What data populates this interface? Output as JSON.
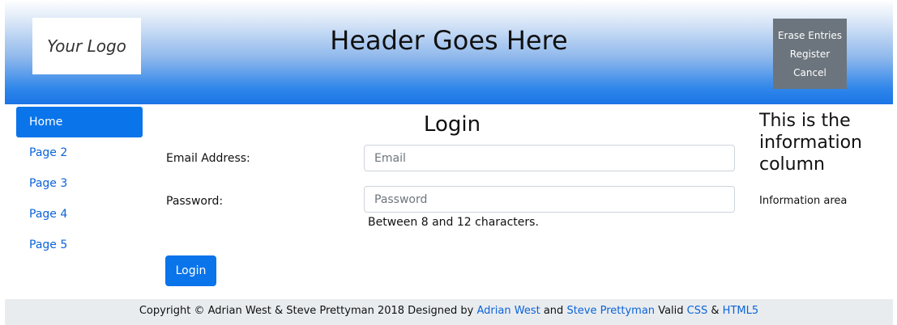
{
  "header": {
    "logo_text": "Your Logo",
    "title": "Header Goes Here",
    "actions": [
      "Erase Entries",
      "Register",
      "Cancel"
    ]
  },
  "sidebar": {
    "items": [
      {
        "label": "Home",
        "active": true
      },
      {
        "label": "Page 2",
        "active": false
      },
      {
        "label": "Page 3",
        "active": false
      },
      {
        "label": "Page 4",
        "active": false
      },
      {
        "label": "Page 5",
        "active": false
      }
    ]
  },
  "main": {
    "title": "Login",
    "email": {
      "label": "Email Address:",
      "placeholder": "Email",
      "value": ""
    },
    "password": {
      "label": "Password:",
      "placeholder": "Password",
      "value": "",
      "hint": "Between 8 and 12 characters."
    },
    "login_button": "Login"
  },
  "info": {
    "title": "This is the information column",
    "text": "Information area"
  },
  "footer": {
    "copyright": "Copyright © Adrian West & Steve Prettyman 2018 Designed by",
    "author1": "Adrian West",
    "and": "and",
    "author2": "Steve Prettyman",
    "valid": "Valid",
    "css": "CSS",
    "amp": "&",
    "html5": "HTML5"
  },
  "colors": {
    "accent": "#0a74ea",
    "action_bg": "#6c757d",
    "footer_bg": "#e9ecef",
    "link": "#0b63d9"
  }
}
